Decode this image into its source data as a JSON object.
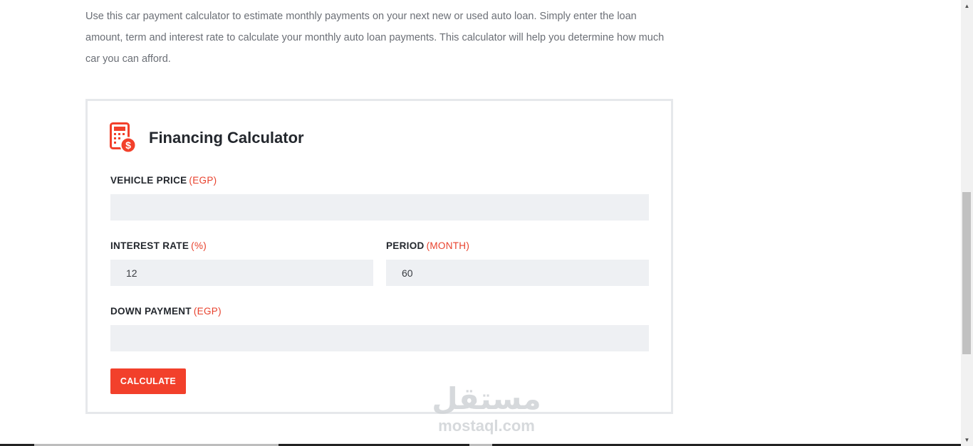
{
  "intro": {
    "text": "Use this car payment calculator to estimate monthly payments on your next new or used auto loan. Simply enter the loan amount, term and interest rate to calculate your monthly auto loan payments. This calculator will help you determine how much car you can afford."
  },
  "calculator": {
    "icon": "calculator-dollar-icon",
    "title": "Financing Calculator",
    "accent_color": "#f2402b",
    "fields": {
      "vehicle_price": {
        "label": "VEHICLE PRICE",
        "unit": "(EGP)",
        "value": ""
      },
      "interest_rate": {
        "label": "INTEREST RATE",
        "unit": "(%)",
        "value": "12"
      },
      "period": {
        "label": "PERIOD",
        "unit": "(MONTH)",
        "value": "60"
      },
      "down_payment": {
        "label": "DOWN PAYMENT",
        "unit": "(EGP)",
        "value": ""
      }
    },
    "button_label": "CALCULATE"
  },
  "watermark": {
    "arabic": "مستقل",
    "latin": "mostaql.com"
  }
}
